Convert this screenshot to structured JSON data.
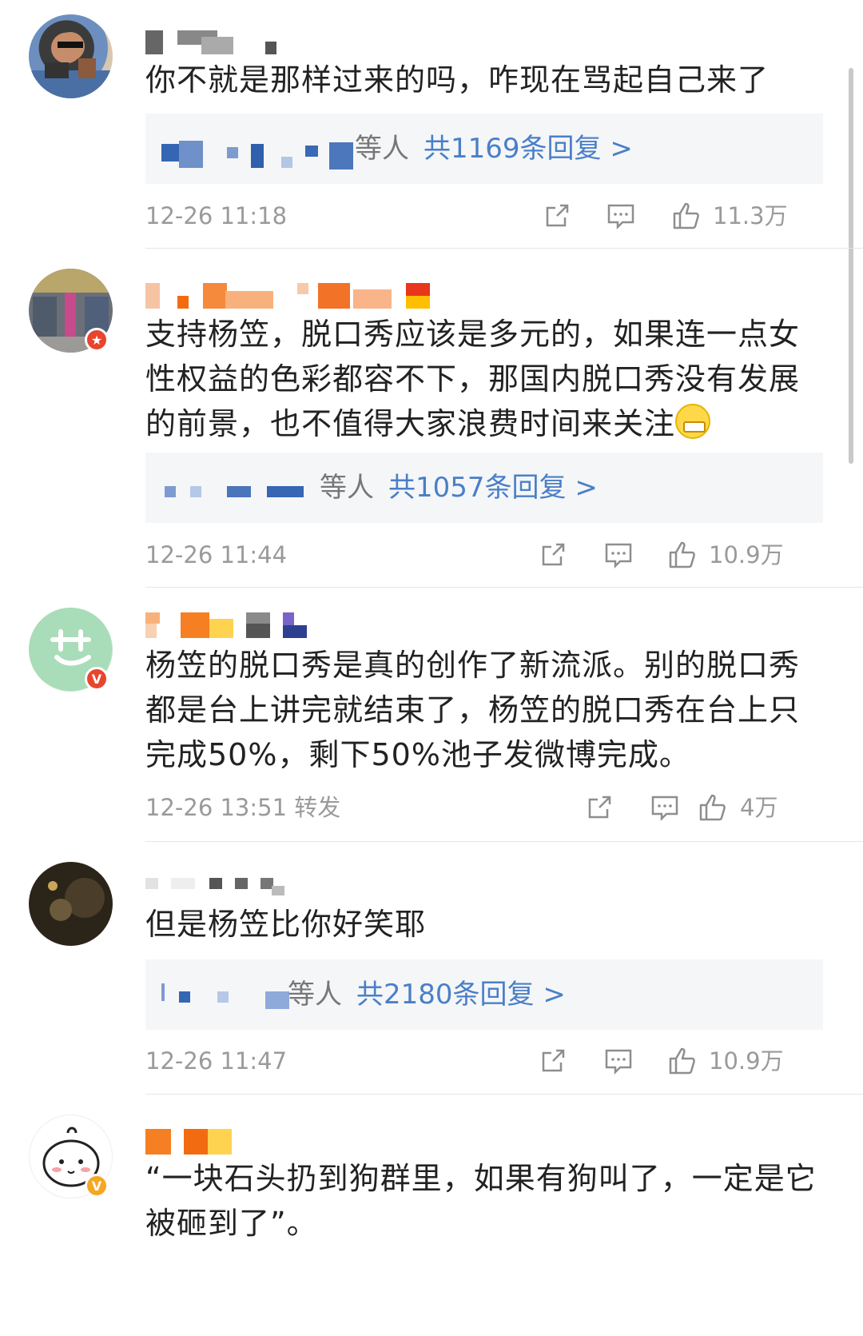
{
  "comments": [
    {
      "text": "你不就是那样过来的吗，咋现在骂起自己来了",
      "reply_suffix": "等人",
      "reply_count": "共1169条回复 >",
      "time": "12-26 11:18",
      "likes": "11.3万"
    },
    {
      "text": "支持杨笠，脱口秀应该是多元的，如果连一点女性权益的色彩都容不下，那国内脱口秀没有发展的前景，也不值得大家浪费时间来关注",
      "reply_suffix": "等人",
      "reply_count": "共1057条回复 >",
      "time": "12-26 11:44",
      "likes": "10.9万"
    },
    {
      "text": "杨笠的脱口秀是真的创作了新流派。别的脱口秀都是台上讲完就结束了，杨笠的脱口秀在台上只完成50%，剩下50%池子发微博完成。",
      "time": "12-26 13:51",
      "forward": "转发",
      "likes": "4万"
    },
    {
      "text": "但是杨笠比你好笑耶",
      "reply_suffix": "等人",
      "reply_count": "共2180条回复 >",
      "time": "12-26 11:47",
      "likes": "10.9万"
    },
    {
      "text": "“一块石头扔到狗群里，如果有狗叫了，一定是它被砸到了”。"
    }
  ],
  "icons": {
    "share": "share-icon",
    "comment": "comment-icon",
    "like": "thumbs-up-icon",
    "emoji": "grinning-face-emoji"
  },
  "colors": {
    "link": "#4a7fc8",
    "muted": "#9a9a9a",
    "reply_bg": "#f5f6f7"
  }
}
